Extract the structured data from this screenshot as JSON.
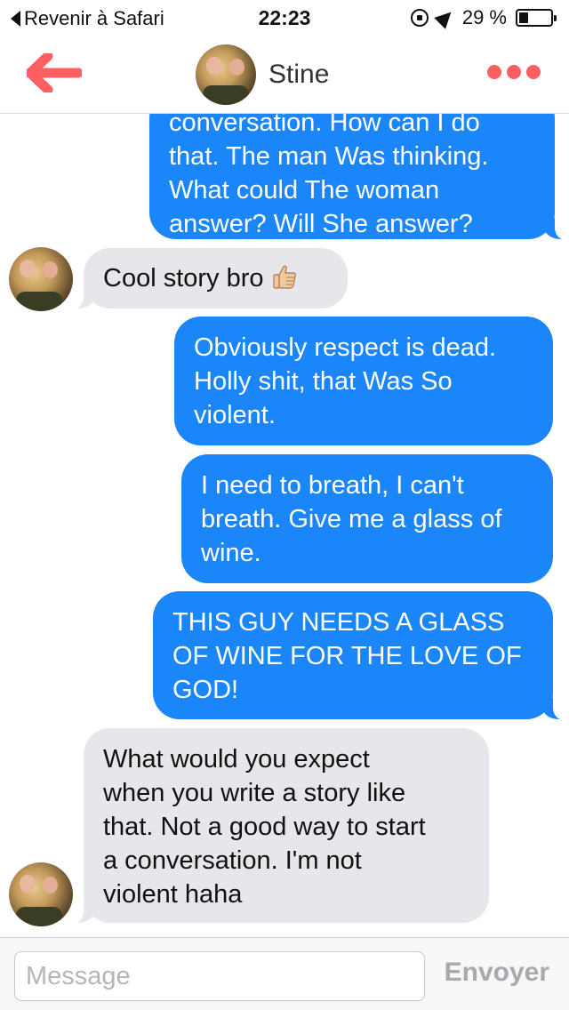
{
  "status_bar": {
    "back_label": "Revenir à Safari",
    "time": "22:23",
    "battery_text": "29 %",
    "battery_level": 0.29
  },
  "header": {
    "contact_name": "Stine",
    "accent_color": "#fd5f63"
  },
  "messages": [
    {
      "direction": "outgoing",
      "lines": [
        "conversation. How can I do",
        "that. The man Was thinking.",
        "What could The woman",
        "answer? Will She answer?"
      ]
    },
    {
      "direction": "incoming",
      "lines": [
        "Cool story bro"
      ],
      "emoji": "thumbs-up-icon"
    },
    {
      "direction": "outgoing",
      "lines": [
        "Obviously respect is dead.",
        "Holly shit, that Was So",
        "violent."
      ]
    },
    {
      "direction": "outgoing",
      "lines": [
        "I need to breath, I can't",
        "breath. Give me a glass of",
        "wine."
      ]
    },
    {
      "direction": "outgoing",
      "lines": [
        "THIS GUY NEEDS A GLASS",
        "OF WINE FOR THE LOVE OF",
        "GOD!"
      ]
    },
    {
      "direction": "incoming",
      "lines": [
        "What would you expect",
        "when you write a story like",
        "that. Not a good way to start",
        "a conversation. I'm not",
        "violent haha"
      ]
    }
  ],
  "composer": {
    "placeholder": "Message",
    "send_label": "Envoyer"
  },
  "colors": {
    "outgoing_bubble": "#1b86f9",
    "incoming_bubble": "#e6e6eb"
  }
}
